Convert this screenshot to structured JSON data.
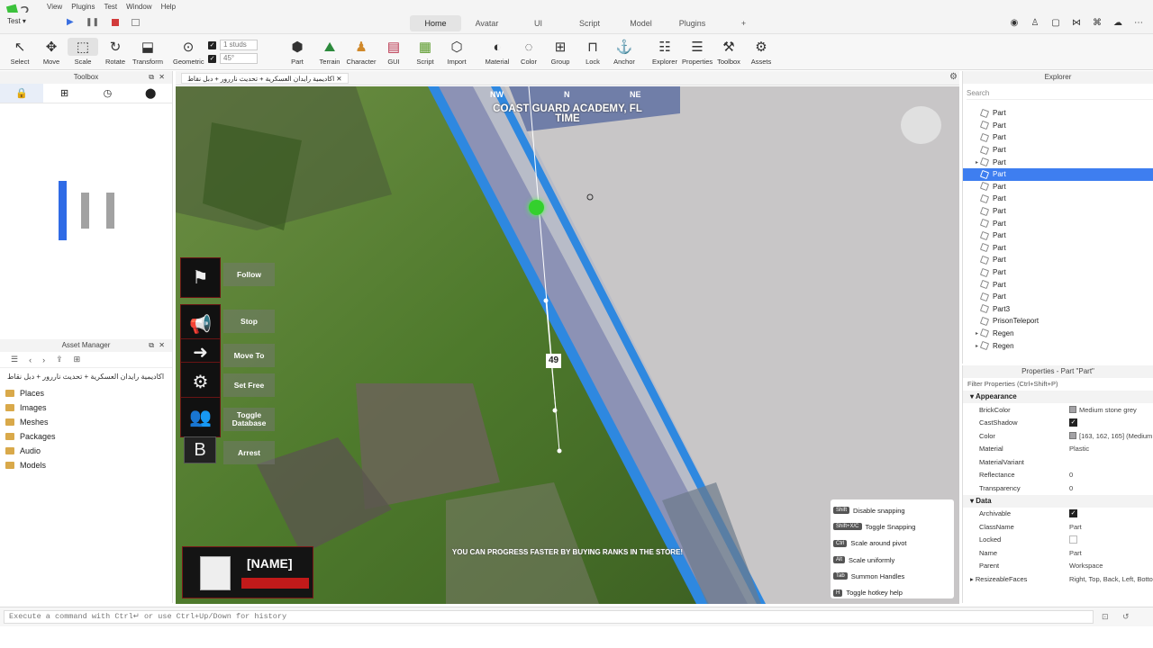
{
  "menubar": {
    "items": [
      "View",
      "Plugins",
      "Test",
      "Window",
      "Help"
    ]
  },
  "place_select": "Test",
  "ribbon_tabs": [
    "Home",
    "Avatar",
    "UI",
    "Script",
    "Model",
    "Plugins",
    "+"
  ],
  "toolbar": {
    "tools": [
      {
        "label": "Select",
        "icon": "cursor-icon",
        "glyph": "↖"
      },
      {
        "label": "Move",
        "icon": "move-icon",
        "glyph": "✥"
      },
      {
        "label": "Scale",
        "icon": "scale-icon",
        "glyph": "⬚"
      },
      {
        "label": "Rotate",
        "icon": "rotate-icon",
        "glyph": "↻"
      },
      {
        "label": "Transform",
        "icon": "transform-icon",
        "glyph": "⬓"
      },
      {
        "label": "Geometric",
        "icon": "geometric-icon",
        "glyph": "⊙"
      },
      {
        "label": "Part",
        "icon": "part-icon",
        "glyph": "⬢"
      },
      {
        "label": "Terrain",
        "icon": "terrain-icon",
        "glyph": "⛰"
      },
      {
        "label": "Character",
        "icon": "character-icon",
        "glyph": "♟"
      },
      {
        "label": "GUI",
        "icon": "gui-icon",
        "glyph": "▤"
      },
      {
        "label": "Script",
        "icon": "script-icon",
        "glyph": "▦"
      },
      {
        "label": "Import",
        "icon": "import-icon",
        "glyph": "⬡"
      },
      {
        "label": "Material",
        "icon": "material-icon",
        "glyph": "◐"
      },
      {
        "label": "Color",
        "icon": "color-icon",
        "glyph": "◌"
      },
      {
        "label": "Group",
        "icon": "group-icon",
        "glyph": "⊞"
      },
      {
        "label": "Lock",
        "icon": "lock-icon",
        "glyph": "⊓"
      },
      {
        "label": "Anchor",
        "icon": "anchor-icon",
        "glyph": "⚓"
      },
      {
        "label": "Explorer",
        "icon": "explorer-icon",
        "glyph": "☷"
      },
      {
        "label": "Properties",
        "icon": "properties-icon",
        "glyph": "☰"
      },
      {
        "label": "Toolbox",
        "icon": "toolbox-icon",
        "glyph": "⚒"
      },
      {
        "label": "Assets",
        "icon": "assets-icon",
        "glyph": "⚙"
      }
    ],
    "move_step": "1 studs",
    "rotate_step": "45°"
  },
  "toolbox": {
    "title": "Toolbox"
  },
  "asset_manager": {
    "title": "Asset Manager",
    "path": "اكاديمية رايدان العسكرية + تحديث ناررور + دبل نقاط",
    "items": [
      "Places",
      "Images",
      "Meshes",
      "Packages",
      "Audio",
      "Models"
    ]
  },
  "viewport": {
    "tab_title": "اكاديمية رايدان العسكرية + تحديث ناررور + دبل نقاط",
    "compass": [
      "NW",
      "N",
      "NE"
    ],
    "location_line1": "COAST GUARD ACADEMY, FL",
    "location_line2": "TIME",
    "marker_value": "49",
    "hud_buttons": [
      {
        "label": "Follow",
        "icon": "flag-icon",
        "glyph": "⚑"
      },
      {
        "label": "Stop",
        "icon": "megaphone-icon",
        "glyph": "📢"
      },
      {
        "label": "Move To",
        "icon": "move-to-icon",
        "glyph": "➜"
      },
      {
        "label": "Set Free",
        "icon": "gears-icon",
        "glyph": "⚙"
      },
      {
        "label": "Toggle Database",
        "icon": "people-icon",
        "glyph": "👥"
      },
      {
        "label": "Arrest",
        "icon": "b-key-icon",
        "glyph": "B"
      }
    ],
    "name_card": "[NAME]",
    "progress_text": "YOU CAN PROGRESS FASTER BY BUYING RANKS IN THE STORE!",
    "hotkeys": [
      {
        "key": "Shift",
        "label": "Disable snapping"
      },
      {
        "key": "Shift+X/C",
        "label": "Toggle Snapping"
      },
      {
        "key": "Ctrl",
        "label": "Scale around pivot"
      },
      {
        "key": "Alt",
        "label": "Scale uniformly"
      },
      {
        "key": "Tab",
        "label": "Summon Handles"
      },
      {
        "key": "H",
        "label": "Toggle hotkey help"
      }
    ]
  },
  "explorer": {
    "title": "Explorer",
    "search_placeholder": "Search",
    "items": [
      "Part",
      "Part",
      "Part",
      "Part",
      "Part",
      "Part",
      "Part",
      "Part",
      "Part",
      "Part",
      "Part",
      "Part",
      "Part",
      "Part",
      "Part",
      "Part",
      "Part3",
      "PrisonTeleport",
      "Regen",
      "Regen"
    ]
  },
  "properties": {
    "title": "Properties - Part \"Part\"",
    "filter": "Filter Properties (Ctrl+Shift+P)",
    "appearance_header": "Appearance",
    "appearance": [
      {
        "name": "BrickColor",
        "value": "Medium stone grey"
      },
      {
        "name": "CastShadow",
        "value": ""
      },
      {
        "name": "Color",
        "value": "[163, 162, 165] (Medium"
      },
      {
        "name": "Material",
        "value": "Plastic"
      },
      {
        "name": "MaterialVariant",
        "value": ""
      },
      {
        "name": "Reflectance",
        "value": "0"
      },
      {
        "name": "Transparency",
        "value": "0"
      }
    ],
    "data_header": "Data",
    "data": [
      {
        "name": "Archivable",
        "value": ""
      },
      {
        "name": "ClassName",
        "value": "Part"
      },
      {
        "name": "Locked",
        "value": ""
      },
      {
        "name": "Name",
        "value": "Part"
      },
      {
        "name": "Parent",
        "value": "Workspace"
      },
      {
        "name": "ResizeableFaces",
        "value": "Right, Top, Back, Left, Botto"
      }
    ]
  },
  "command_bar": {
    "placeholder": "Execute a command with Ctrl↵ or use Ctrl+Up/Down for history"
  }
}
